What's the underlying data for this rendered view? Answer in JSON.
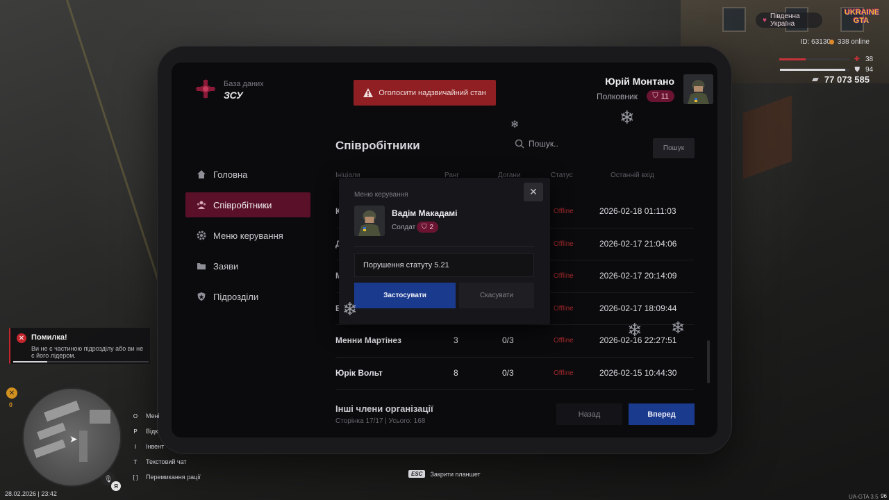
{
  "tablet": {
    "brand_sub": "База даних",
    "brand_main": "ЗСУ",
    "emergency_button": "Оголосити надзвичайний стан",
    "user": {
      "name": "Юрій Монтано",
      "rank": "Полковник",
      "level": "11"
    },
    "nav": [
      {
        "label": "Головна",
        "icon": "home-icon",
        "active": false
      },
      {
        "label": "Співробітники",
        "icon": "users-icon",
        "active": true
      },
      {
        "label": "Меню керування",
        "icon": "gear-icon",
        "active": false
      },
      {
        "label": "Заяви",
        "icon": "folder-icon",
        "active": false
      },
      {
        "label": "Підрозділи",
        "icon": "shield-icon",
        "active": false
      }
    ],
    "section_title": "Співробітники",
    "search": {
      "placeholder": "Пошук..",
      "button": "Пошук"
    },
    "columns": [
      "Ініціали",
      "Ранг",
      "Догани",
      "Статус",
      "Останній вхід"
    ],
    "rows": [
      {
        "name": "К",
        "rank": "",
        "warnings": "",
        "status": "Offline",
        "last_login": "2026-02-18 01:11:03"
      },
      {
        "name": "Д",
        "rank": "",
        "warnings": "",
        "status": "Offline",
        "last_login": "2026-02-17 21:04:06"
      },
      {
        "name": "М",
        "rank": "",
        "warnings": "",
        "status": "Offline",
        "last_login": "2026-02-17 20:14:09"
      },
      {
        "name": "Е",
        "rank": "",
        "warnings": "",
        "status": "Offline",
        "last_login": "2026-02-17 18:09:44"
      },
      {
        "name": "Менни Мартінез",
        "rank": "3",
        "warnings": "0/3",
        "status": "Offline",
        "last_login": "2026-02-16 22:27:51"
      },
      {
        "name": "Юрік Вольт",
        "rank": "8",
        "warnings": "0/3",
        "status": "Offline",
        "last_login": "2026-02-15 10:44:30"
      }
    ],
    "footer": {
      "title": "Інші члени організації",
      "subtitle": "Сторінка 17/17 | Усього: 168"
    },
    "pagination": {
      "back": "Назад",
      "forward": "Вперед"
    }
  },
  "modal": {
    "label": "Меню керування",
    "close_icon": "close-icon",
    "member": {
      "name": "Вадім Макадамі",
      "rank": "Солдат",
      "level": "2"
    },
    "reason_value": "Порушення статуту 5.21",
    "apply": "Застосувати",
    "cancel": "Скасувати"
  },
  "hud": {
    "server": "Південна Україна",
    "logo_line1": "UKRAINE",
    "logo_line2": "GTA",
    "id": "ID: 63130",
    "online": "338 online",
    "health": 38,
    "armor": 94,
    "money": "77 073 585"
  },
  "toast": {
    "title": "Помилка!",
    "message": "Ви не є частиною підрозділу або ви не є його лідером.",
    "progress": 0.25
  },
  "minimap": {
    "badge_value": "0",
    "lang": "Я"
  },
  "datetime": "28.02.2026 | 23:42",
  "hotkeys": [
    {
      "key": "O",
      "label": "Мені"
    },
    {
      "key": "P",
      "label": "Відк"
    },
    {
      "key": "I",
      "label": "Інвент"
    },
    {
      "key": "T",
      "label": "Текстовий чат"
    },
    {
      "key": "[ ]",
      "label": "Перемикання рації"
    }
  ],
  "esc_hint": {
    "key": "ESC",
    "label": "Закрити планшет"
  },
  "version": "UA-GTA 3.5",
  "fps": "96",
  "colors": {
    "accent": "#5b1029",
    "primary_button": "#1a3a8e",
    "danger": "#8f1f22",
    "offline": "#a3282b"
  }
}
